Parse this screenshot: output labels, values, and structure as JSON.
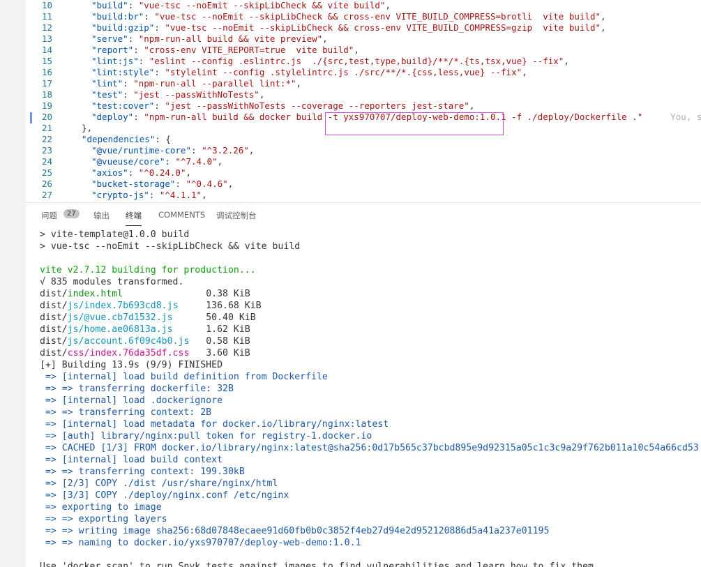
{
  "editor": {
    "lines": [
      {
        "n": "10",
        "k": "\"build\"",
        "v": "\"vue-tsc --noEmit --skipLibCheck && vite build\"",
        "end": ","
      },
      {
        "n": "11",
        "k": "\"build:br\"",
        "v": "\"vue-tsc --noEmit --skipLibCheck && cross-env VITE_BUILD_COMPRESS=brotli  vite build\"",
        "end": ","
      },
      {
        "n": "12",
        "k": "\"build:gzip\"",
        "v": "\"vue-tsc --noEmit --skipLibCheck && cross-env VITE_BUILD_COMPRESS=gzip  vite build\"",
        "end": ","
      },
      {
        "n": "13",
        "k": "\"serve\"",
        "v": "\"npm-run-all build && vite preview\"",
        "end": ","
      },
      {
        "n": "14",
        "k": "\"report\"",
        "v": "\"cross-env VITE_REPORT=true  vite build\"",
        "end": ","
      },
      {
        "n": "15",
        "k": "\"lint:js\"",
        "v": "\"eslint --config .eslintrc.js  ./{src,test,type,build}/**/*.{ts,tsx,vue} --fix\"",
        "end": ","
      },
      {
        "n": "16",
        "k": "\"lint:style\"",
        "v": "\"stylelint --config .stylelintrc.js ./src/**/*.{css,less,vue} --fix\"",
        "end": ","
      },
      {
        "n": "17",
        "k": "\"lint\"",
        "v": "\"npm-run-all --parallel lint:*\"",
        "end": ","
      },
      {
        "n": "18",
        "k": "\"test\"",
        "v": "\"jest --passWithNoTests\"",
        "end": ","
      },
      {
        "n": "19",
        "k": "\"test:cover\"",
        "v": "\"jest --passWithNoTests --coverage --reporters jest-stare\"",
        "end": ","
      },
      {
        "n": "20",
        "k": "\"deploy\"",
        "v": "\"npm-run-all build && docker build -t yxs970707/deploy-web-demo:1.0.1 -f ./deploy/Dockerfile .\"",
        "end": "",
        "ghost": "You, sec"
      },
      {
        "n": "21",
        "k": "",
        "v": "},",
        "end": "",
        "indent": "    "
      },
      {
        "n": "22",
        "k": "\"dependencies\"",
        "v": "{",
        "end": "",
        "indent": "    ",
        "blue": true
      },
      {
        "n": "23",
        "k": "\"@vue/runtime-core\"",
        "v": "\"^3.2.26\"",
        "end": ","
      },
      {
        "n": "24",
        "k": "\"@vueuse/core\"",
        "v": "\"^7.4.0\"",
        "end": ","
      },
      {
        "n": "25",
        "k": "\"axios\"",
        "v": "\"^0.24.0\"",
        "end": ","
      },
      {
        "n": "26",
        "k": "\"bucket-storage\"",
        "v": "\"^0.4.6\"",
        "end": ","
      },
      {
        "n": "27",
        "k": "\"crypto-js\"",
        "v": "\"^4.1.1\"",
        "end": ","
      }
    ]
  },
  "panel": {
    "tabs": [
      "问题",
      "输出",
      "终端",
      "COMMENTS",
      "调试控制台"
    ],
    "problems_count": "27",
    "active_tab": "终端"
  },
  "terminal": {
    "lines": [
      {
        "t": "> vite-template@1.0.0 build",
        "c": "c-default"
      },
      {
        "t": "> vue-tsc --noEmit --skipLibCheck && vite build",
        "c": "c-default"
      },
      {
        "t": "",
        "c": "c-default"
      },
      {
        "t": "vite v2.7.12 building for production...",
        "c": "c-green"
      },
      {
        "t": "√ 835 modules transformed.",
        "c": "c-default"
      },
      {
        "t": "dist/index.html               0.38 KiB",
        "c": "c-default"
      },
      {
        "t": "dist/js/index.7b693cd8.js     136.68 KiB",
        "c": "c-default"
      },
      {
        "t": "dist/js/@vue.cb7d1532.js      50.40 KiB",
        "c": "c-default"
      },
      {
        "t": "dist/js/home.ae06813a.js      1.62 KiB",
        "c": "c-default"
      },
      {
        "t": "dist/js/account.6f09c4b0.js   0.58 KiB",
        "c": "c-default"
      },
      {
        "t": "dist/css/index.76da35df.css   3.60 KiB",
        "c": "c-default"
      },
      {
        "t": "[+] Building 13.9s (9/9) FINISHED",
        "c": "c-default"
      },
      {
        "t": " => [internal] load build definition from Dockerfile",
        "c": "c-blue"
      },
      {
        "t": " => => transferring dockerfile: 32B",
        "c": "c-blue"
      },
      {
        "t": " => [internal] load .dockerignore",
        "c": "c-blue"
      },
      {
        "t": " => => transferring context: 2B",
        "c": "c-blue"
      },
      {
        "t": " => [internal] load metadata for docker.io/library/nginx:latest",
        "c": "c-blue"
      },
      {
        "t": " => [auth] library/nginx:pull token for registry-1.docker.io",
        "c": "c-blue"
      },
      {
        "t": " => CACHED [1/3] FROM docker.io/library/nginx:latest@sha256:0d17b565c37bcbd895e9d92315a05c1c3c9a29f762b011a10c54a66cd53",
        "c": "c-blue"
      },
      {
        "t": " => [internal] load build context",
        "c": "c-blue"
      },
      {
        "t": " => => transferring context: 199.30kB",
        "c": "c-blue"
      },
      {
        "t": " => [2/3] COPY ./dist /usr/share/nginx/html",
        "c": "c-blue"
      },
      {
        "t": " => [3/3] COPY ./deploy/nginx.conf /etc/nginx",
        "c": "c-blue"
      },
      {
        "t": " => exporting to image",
        "c": "c-blue"
      },
      {
        "t": " => => exporting layers",
        "c": "c-blue"
      },
      {
        "t": " => => writing image sha256:68d07848ecaee91d60fb0b0c3852f4eb27d94e2d952120886d5a41a237e01195",
        "c": "c-blue"
      },
      {
        "t": " => => naming to docker.io/yxs970707/deploy-web-demo:1.0.1",
        "c": "c-blue"
      },
      {
        "t": "",
        "c": "c-default"
      },
      {
        "t": "Use 'docker scan' to run Snyk tests against images to find vulnerabilities and learn how to fix them",
        "c": "c-default"
      }
    ]
  }
}
